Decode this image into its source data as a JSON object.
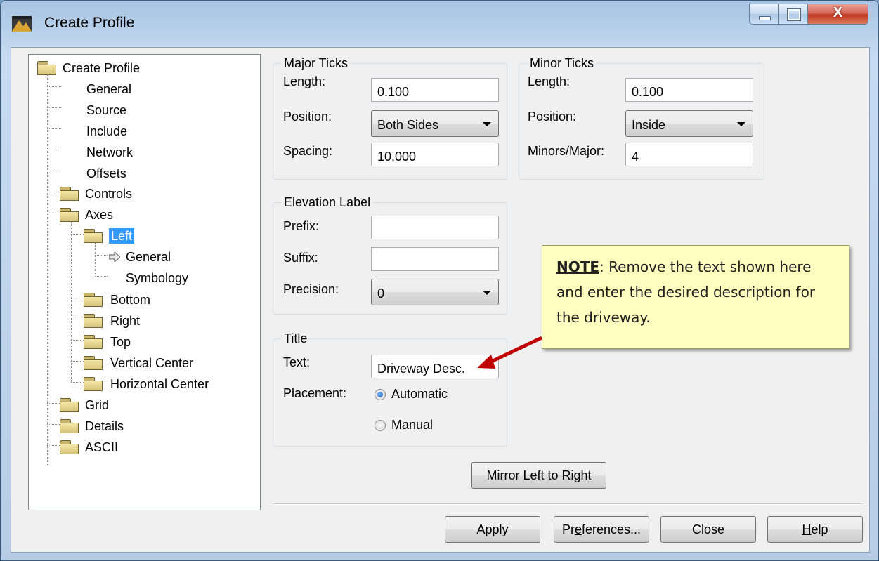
{
  "window": {
    "title": "Create Profile",
    "close_glyph": "X"
  },
  "tree": [
    {
      "label": "Create Profile",
      "icon": "folder-open-icon"
    },
    {
      "label": "General"
    },
    {
      "label": "Source"
    },
    {
      "label": "Include"
    },
    {
      "label": "Network"
    },
    {
      "label": "Offsets"
    },
    {
      "label": "Controls",
      "icon": "folder-icon"
    },
    {
      "label": "Axes",
      "icon": "folder-open-icon"
    },
    {
      "label": "Left",
      "icon": "folder-open-icon",
      "selected": true
    },
    {
      "label": "General",
      "icon": "arrow-right-icon"
    },
    {
      "label": "Symbology"
    },
    {
      "label": "Bottom",
      "icon": "folder-icon"
    },
    {
      "label": "Right",
      "icon": "folder-icon"
    },
    {
      "label": "Top",
      "icon": "folder-icon"
    },
    {
      "label": "Vertical Center",
      "icon": "folder-icon"
    },
    {
      "label": "Horizontal Center",
      "icon": "folder-icon"
    },
    {
      "label": "Grid",
      "icon": "folder-icon"
    },
    {
      "label": "Details",
      "icon": "folder-icon"
    },
    {
      "label": "ASCII",
      "icon": "folder-icon"
    }
  ],
  "major_ticks": {
    "title": "Major Ticks",
    "length_label": "Length:",
    "length_value": "0.100",
    "position_label": "Position:",
    "position_value": "Both Sides",
    "spacing_label": "Spacing:",
    "spacing_value": "10.000"
  },
  "minor_ticks": {
    "title": "Minor Ticks",
    "length_label": "Length:",
    "length_value": "0.100",
    "position_label": "Position:",
    "position_value": "Inside",
    "minors_label": "Minors/Major:",
    "minors_value": "4"
  },
  "elevation_label": {
    "title": "Elevation Label",
    "prefix_label": "Prefix:",
    "prefix_value": "",
    "suffix_label": "Suffix:",
    "suffix_value": "",
    "precision_label": "Precision:",
    "precision_value": "0"
  },
  "title_group": {
    "title": "Title",
    "text_label": "Text:",
    "text_value": "Driveway Desc.",
    "placement_label": "Placement:",
    "automatic_label": "Automatic",
    "manual_label": "Manual",
    "selected": "Automatic"
  },
  "mirror_button": "Mirror Left to Right",
  "buttons": {
    "apply": "Apply",
    "preferences_pre": "Pr",
    "preferences_acc": "e",
    "preferences_post": "ferences...",
    "close": "Close",
    "help_acc": "H",
    "help_post": "elp"
  },
  "note": {
    "label": "NOTE",
    "text": ": Remove the text shown here and enter the desired description for the driveway."
  },
  "colors": {
    "selection": "#3399ff",
    "note_bg": "#ffffc0",
    "arrow": "#c00000"
  }
}
